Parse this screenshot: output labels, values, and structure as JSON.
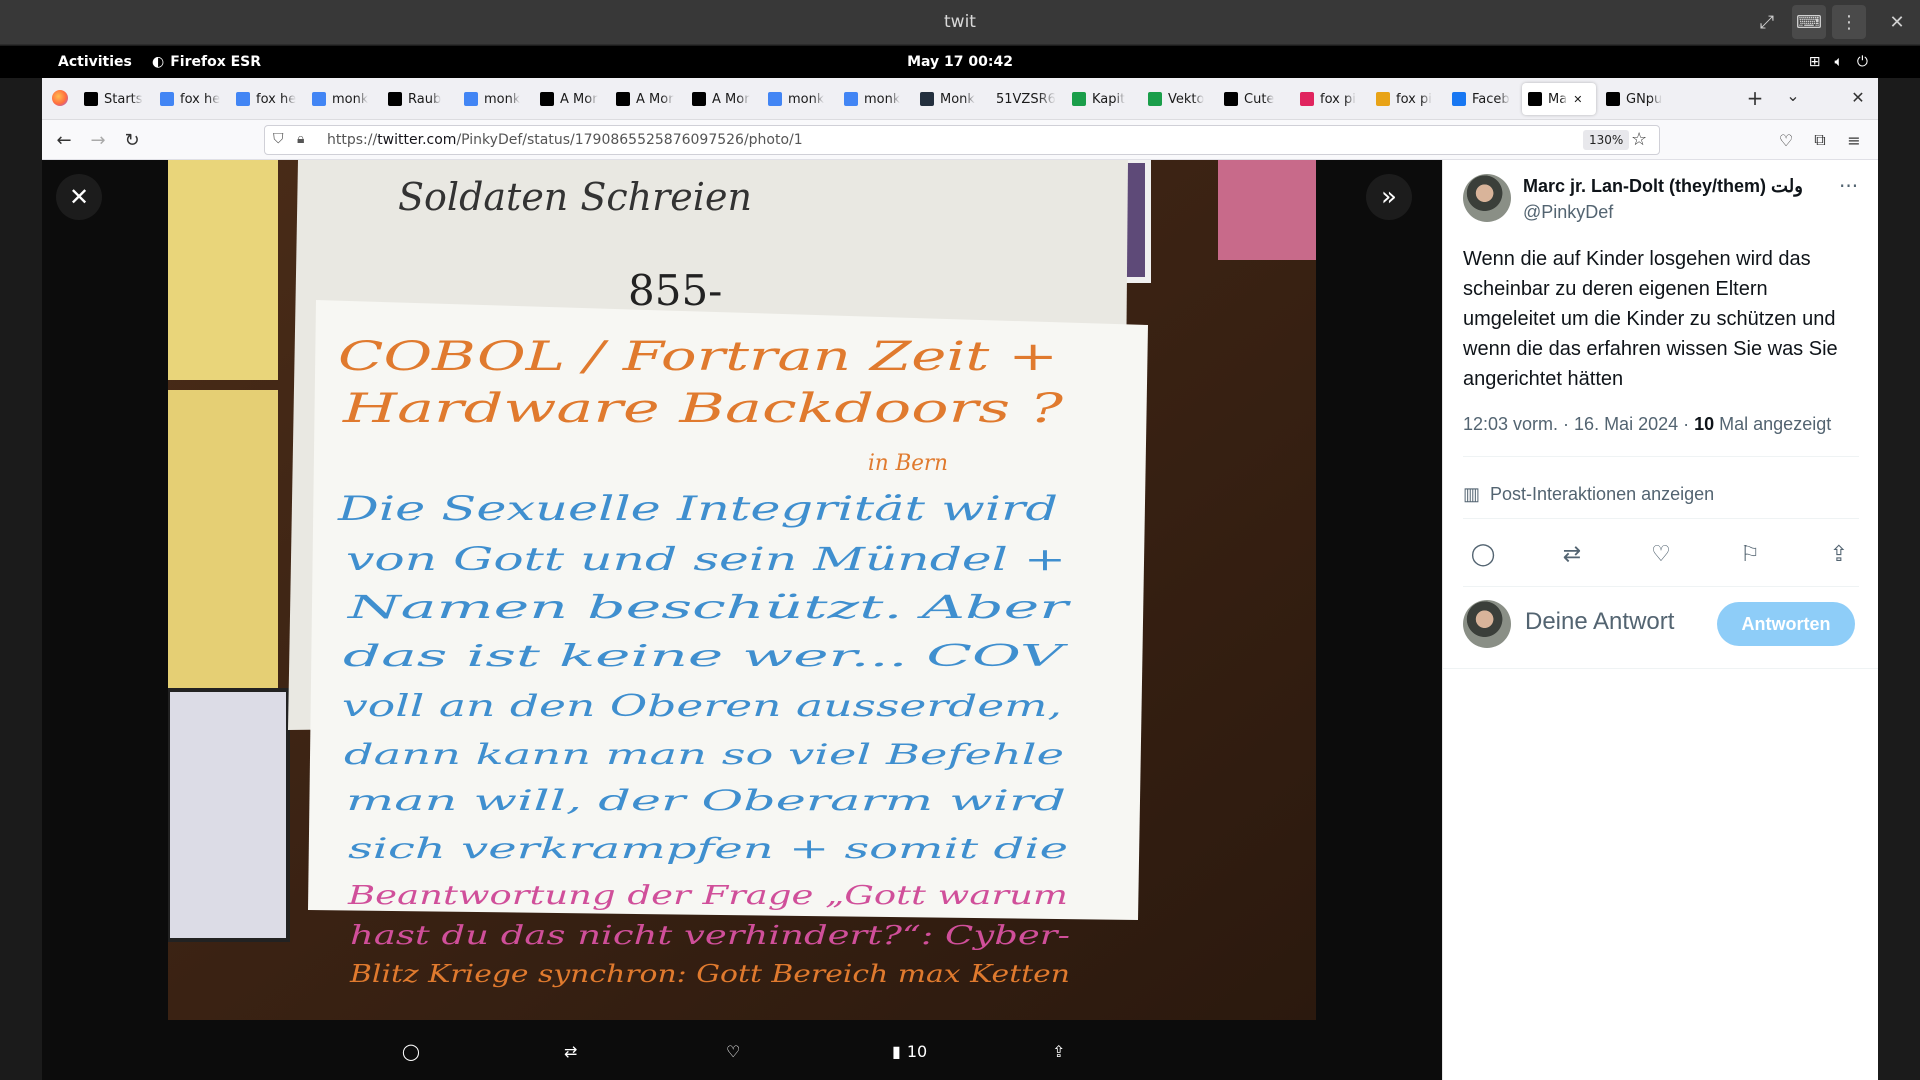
{
  "window": {
    "title": "twit"
  },
  "gnome": {
    "activities": "Activities",
    "app_name": "Firefox ESR",
    "clock": "May 17  00:42"
  },
  "tabs": [
    {
      "label": "Starts",
      "favicon": "x-icon",
      "color": "#000000"
    },
    {
      "label": "fox he",
      "favicon": "google-icon",
      "color": "#4285f4"
    },
    {
      "label": "fox he",
      "favicon": "google-icon",
      "color": "#4285f4"
    },
    {
      "label": "monk",
      "favicon": "google-icon",
      "color": "#4285f4"
    },
    {
      "label": "Raub",
      "favicon": "x-icon",
      "color": "#000000"
    },
    {
      "label": "monk",
      "favicon": "google-icon",
      "color": "#4285f4"
    },
    {
      "label": "A Mor",
      "favicon": "x-icon",
      "color": "#000000"
    },
    {
      "label": "A Mor",
      "favicon": "x-icon",
      "color": "#000000"
    },
    {
      "label": "A Mor",
      "favicon": "x-icon",
      "color": "#000000"
    },
    {
      "label": "monk",
      "favicon": "google-icon",
      "color": "#4285f4"
    },
    {
      "label": "monk",
      "favicon": "google-icon",
      "color": "#4285f4"
    },
    {
      "label": "Monk",
      "favicon": "amazon-icon",
      "color": "#232f3e"
    },
    {
      "label": "51VZSR6",
      "favicon": "none",
      "color": "#ffffff"
    },
    {
      "label": "Kapit",
      "favicon": "green-icon",
      "color": "#1a9e4a"
    },
    {
      "label": "Vekto",
      "favicon": "green-icon",
      "color": "#1a9e4a"
    },
    {
      "label": "Cute",
      "favicon": "x-icon",
      "color": "#000000"
    },
    {
      "label": "fox pi",
      "favicon": "red-icon",
      "color": "#e0245e"
    },
    {
      "label": "fox pi",
      "favicon": "gallery-icon",
      "color": "#e8a317"
    },
    {
      "label": "Faceb",
      "favicon": "facebook-icon",
      "color": "#1877f2"
    },
    {
      "label": "Ma",
      "favicon": "x-icon",
      "color": "#000000",
      "active": true
    },
    {
      "label": "GNpu",
      "favicon": "x-icon",
      "color": "#000000"
    }
  ],
  "url": {
    "scheme": "https://",
    "host": "twitter.com",
    "path": "/PinkyDef/status/1790865525876097526/photo/1",
    "zoom": "130%"
  },
  "photo": {
    "lines": [
      {
        "text": "COBOL / Fortran Zeit +",
        "color": "#e07a2e"
      },
      {
        "text": "Hardware Backdoors ?",
        "color": "#e07a2e"
      },
      {
        "text": "in Bern",
        "color": "#e07a2e"
      },
      {
        "text": "Die Sexuelle Integrität wird",
        "color": "#3f8fcf"
      },
      {
        "text": "von Gott und sein Mündel +",
        "color": "#3f8fcf"
      },
      {
        "text": "Namen beschützt. Aber",
        "color": "#3f8fcf"
      },
      {
        "text": "das ist keine wer... COV",
        "color": "#3f8fcf"
      },
      {
        "text": "voll an den Oberen ausserdem,",
        "color": "#3f8fcf"
      },
      {
        "text": "dann kann man so viel Befehle",
        "color": "#3f8fcf"
      },
      {
        "text": "man will, der Oberarm wird",
        "color": "#3f8fcf"
      },
      {
        "text": "sich verkrampfen + somit die",
        "color": "#3f8fcf"
      },
      {
        "text": "Beantwortung der Frage „Gott warum",
        "color": "#d04f9a"
      },
      {
        "text": "hast du das nicht verhindert?“: Cyber-",
        "color": "#d04f9a"
      },
      {
        "text": "Blitz Kriege synchron: Gott Bereich max Ketten",
        "color": "#e07a2e"
      }
    ],
    "top_text": "Soldaten Schreien",
    "number_text": "855-"
  },
  "photo_actions": {
    "views": "10"
  },
  "tweet": {
    "author_name": "Marc jr. Lan-Dolt (they/them) ولت",
    "handle": "@PinkyDef",
    "text": "Wenn die auf Kinder losgehen wird das scheinbar zu deren eigenen Eltern umgeleitet um die Kinder zu schützen und wenn die das erfahren wissen Sie was Sie angerichtet hätten",
    "time": "12:03 vorm. · 16. Mai 2024 · ",
    "views_count": "10",
    "views_label": " Mal angezeigt",
    "analytics": "Post-Interaktionen anzeigen",
    "reply_placeholder": "Deine Antwort",
    "reply_button": "Antworten"
  }
}
